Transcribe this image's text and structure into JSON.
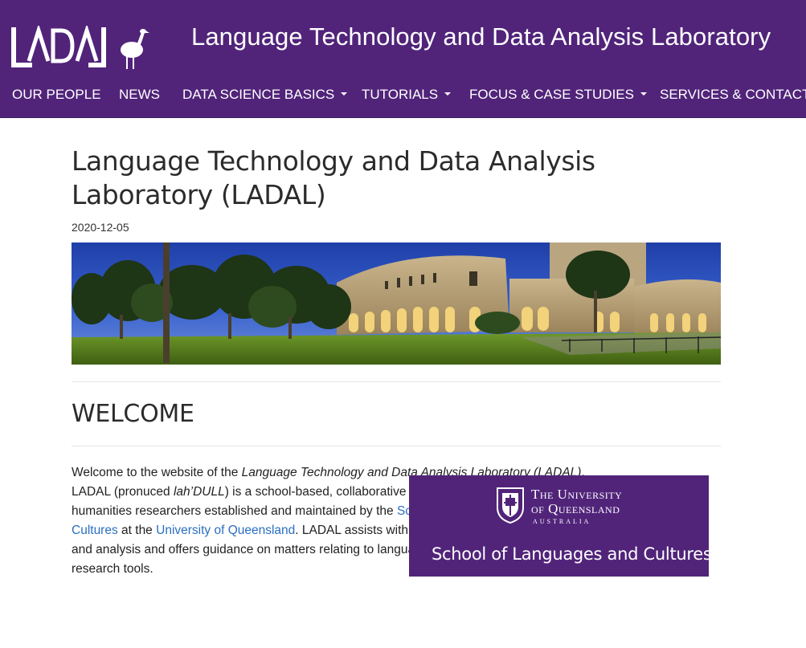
{
  "header": {
    "logo_text": "LADAL",
    "site_title": "Language Technology and Data Analysis Laboratory",
    "nav": [
      {
        "label": "OUR PEOPLE",
        "dropdown": false
      },
      {
        "label": "NEWS",
        "dropdown": false
      },
      {
        "label": "DATA SCIENCE BASICS",
        "dropdown": true
      },
      {
        "label": "TUTORIALS",
        "dropdown": true
      },
      {
        "label": "FOCUS & CASE STUDIES",
        "dropdown": true
      },
      {
        "label": "SERVICES & CONTACT",
        "dropdown": false
      }
    ]
  },
  "main": {
    "title": "Language Technology and Data Analysis Laboratory (LADAL)",
    "date": "2020-12-05",
    "section_heading": "WELCOME",
    "intro": {
      "p1": "Welcome to the website of the ",
      "em_name": "Language Technology and Data Analysis Laboratory (LADAL)",
      "p2": ". LADAL (pronuced ",
      "em_pron": "lah’DULL",
      "p3": ") is a school-based, collaborative support infrastructure for digital humanities researchers established and maintained by the ",
      "link_school": "School of Languages and Cultures",
      "p4": " at the ",
      "link_uq": "University of Queensland",
      "p5": ". LADAL assists with data processing, visualization, and analysis and offers guidance on matters relating to language technology and digital research tools."
    },
    "uq_box": {
      "name_line1": "The University",
      "name_line2": "of Queensland",
      "country": "AUSTRALIA",
      "school": "School of Languages and Cultures"
    }
  },
  "colors": {
    "brand_purple": "#51247a",
    "link_blue": "#2a6fc2"
  }
}
